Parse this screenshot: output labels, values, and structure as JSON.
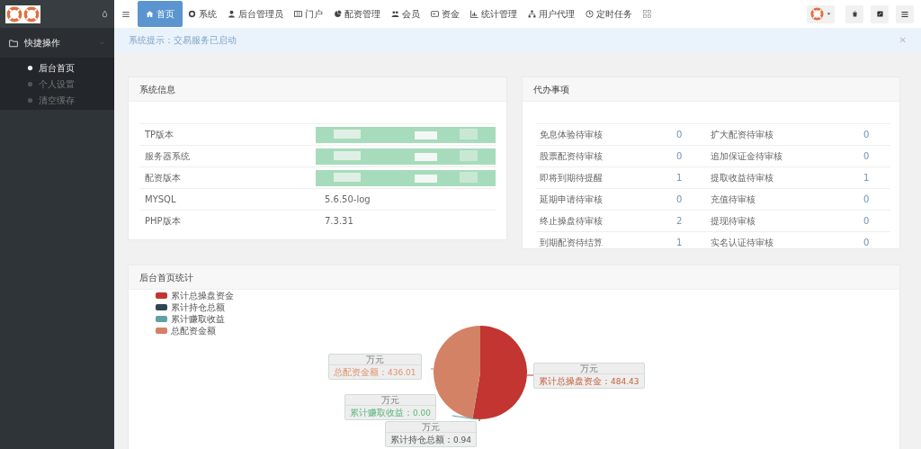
{
  "sidebar": {
    "section": {
      "label": "快捷操作",
      "expanded": true
    },
    "items": [
      {
        "label": "后台首页",
        "selected": true
      },
      {
        "label": "个人设置",
        "selected": false
      },
      {
        "label": "清空缓存",
        "selected": false
      }
    ]
  },
  "nav": {
    "items": [
      {
        "label": "首页",
        "selected": true
      },
      {
        "label": "系统",
        "selected": false
      },
      {
        "label": "后台管理员",
        "selected": false
      },
      {
        "label": "门户",
        "selected": false
      },
      {
        "label": "配资管理",
        "selected": false
      },
      {
        "label": "会员",
        "selected": false
      },
      {
        "label": "资金",
        "selected": false
      },
      {
        "label": "统计管理",
        "selected": false
      },
      {
        "label": "用户代理",
        "selected": false
      },
      {
        "label": "定时任务",
        "selected": false
      }
    ]
  },
  "alert": {
    "text": "系统提示：交易服务已启动",
    "close": "✕"
  },
  "system_info": {
    "title": "系统信息",
    "rows": [
      {
        "label": "TP版本",
        "redacted": true
      },
      {
        "label": "服务器系统",
        "redacted": true
      },
      {
        "label": "配资版本",
        "redacted": true
      },
      {
        "label": "MYSQL",
        "value": "5.6.50-log"
      },
      {
        "label": "PHP版本",
        "value": "7.3.31"
      }
    ]
  },
  "todo": {
    "title": "代办事项",
    "rows": [
      {
        "label_1": "免息体验待审核",
        "count_1": "0",
        "label_2": "扩大配资待审核",
        "count_2": "0"
      },
      {
        "label_1": "股票配资待审核",
        "count_1": "0",
        "label_2": "追加保证金待审核",
        "count_2": "0"
      },
      {
        "label_1": "即将到期待提醒",
        "count_1": "1",
        "label_2": "提取收益待审核",
        "count_2": "1"
      },
      {
        "label_1": "延期申请待审核",
        "count_1": "0",
        "label_2": "充值待审核",
        "count_2": "0"
      },
      {
        "label_1": "终止操盘待审核",
        "count_1": "2",
        "label_2": "提现待审核",
        "count_2": "0"
      },
      {
        "label_1": "到期配资待结算",
        "count_1": "1",
        "label_2": "实名认证待审核",
        "count_2": "0"
      }
    ]
  },
  "stats": {
    "chart_data": {
      "type": "pie",
      "title": "后台首页统计",
      "categories": [
        "累计总操盘资金",
        "累计持仓总额",
        "累计赚取收益",
        "总配资金额"
      ],
      "values": [
        484.43,
        0.94,
        0.0,
        436.01
      ],
      "colors": [
        "#c23531",
        "#2f4554",
        "#61a0a8",
        "#d48265"
      ],
      "legend": true,
      "data_labels": true
    },
    "callouts": [
      {
        "unit": "万元",
        "label": "总配资金额：",
        "value": "436.01"
      },
      {
        "unit": "万元",
        "label": "累计总操盘资金：",
        "value": "484.43"
      },
      {
        "unit": "万元",
        "label": "累计赚取收益：",
        "value": "0.00"
      },
      {
        "unit": "万元",
        "label": "累计持仓总额：",
        "value": "0.94"
      }
    ]
  }
}
